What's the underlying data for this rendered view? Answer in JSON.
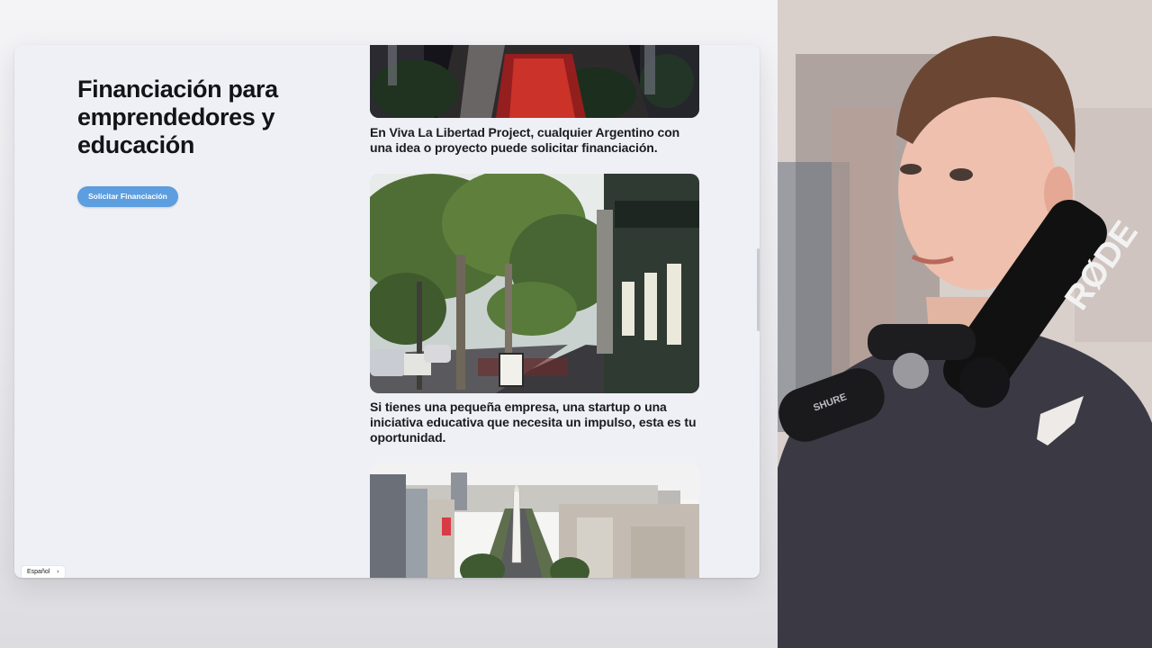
{
  "page": {
    "hero_title": "Financiación para emprendedores y educación",
    "cta_label": "Solicitar Financiación"
  },
  "feed": {
    "captions": [
      "En Viva La Libertad Project, cualquier Argentino con una idea o proyecto puede solicitar financiación.",
      "Si tienes una pequeña empresa, una startup o una iniciativa educativa que necesita un impulso, esta es tu oportunidad."
    ],
    "photos": [
      "night-avenue-traffic-photo",
      "tree-lined-street-cafe-photo",
      "obelisco-aerial-city-photo"
    ]
  },
  "language_selector": {
    "label": "Español"
  },
  "webcam": {
    "mic_brand": "RØDE",
    "mount_brand": "SHURE"
  },
  "colors": {
    "accent": "#5c9edf",
    "window_bg": "#eff0f6",
    "text": "#141418"
  }
}
